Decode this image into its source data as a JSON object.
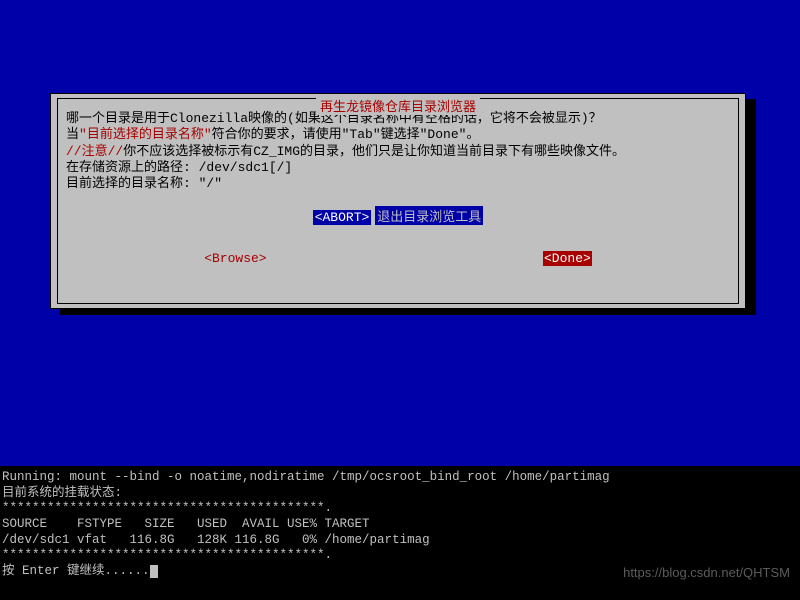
{
  "dialog": {
    "title": "再生龙镜像仓库目录浏览器",
    "line1a": "哪一个目录是用于Clonezilla映像的(如果这个目录名称中有空格的话，它将不会被显示)？",
    "line2a": "当",
    "line2b": "\"目前选择的目录名称\"",
    "line2c": "符合你的要求，请使用\"Tab\"键选择\"Done\"。",
    "line3a": "//注意//",
    "line3b": "你不应该选择被标示有CZ_IMG的目录，他们只是让你知道当前目录下有哪些映像文件。",
    "line4": "在存储资源上的路径: /dev/sdc1[/]",
    "line5": "目前选择的目录名称: \"/\"",
    "abort": "<ABORT>",
    "abort_label": "退出目录浏览工具",
    "browse": "<Browse>",
    "done": "<Done>"
  },
  "terminal": {
    "l1": "Running: mount --bind -o noatime,nodiratime /tmp/ocsroot_bind_root /home/partimag",
    "l2": "目前系统的挂载状态:",
    "l3": "*******************************************.",
    "l4": "SOURCE    FSTYPE   SIZE   USED  AVAIL USE% TARGET",
    "l5": "/dev/sdc1 vfat   116.8G   128K 116.8G   0% /home/partimag",
    "l6": "*******************************************.",
    "l7": "按 Enter 键继续......"
  },
  "watermark": "https://blog.csdn.net/QHTSM"
}
